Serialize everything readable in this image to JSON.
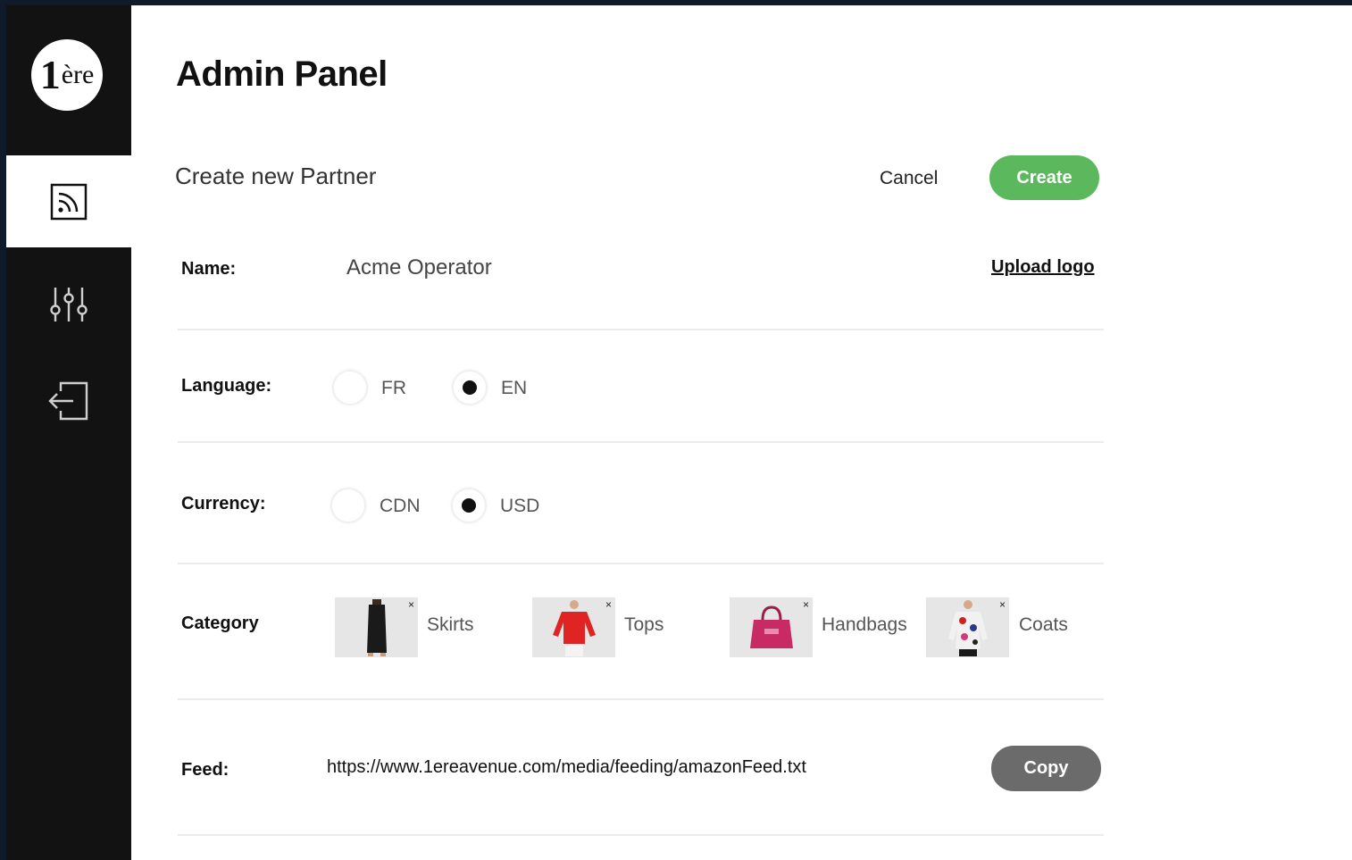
{
  "header": {
    "title": "Admin Panel"
  },
  "sidebar": {
    "logo": {
      "main": "1",
      "sup": "ère"
    },
    "items": [
      {
        "icon": "rss-feed-icon",
        "active": true
      },
      {
        "icon": "sliders-icon",
        "active": false
      },
      {
        "icon": "logout-icon",
        "active": false
      }
    ]
  },
  "form": {
    "subtitle": "Create new Partner",
    "cancel_label": "Cancel",
    "create_label": "Create",
    "name": {
      "label": "Name:",
      "value": "Acme Operator",
      "upload_label": "Upload logo"
    },
    "language": {
      "label": "Language:",
      "options": [
        {
          "label": "FR",
          "selected": false
        },
        {
          "label": "EN",
          "selected": true
        }
      ]
    },
    "currency": {
      "label": "Currency:",
      "options": [
        {
          "label": "CDN",
          "selected": false
        },
        {
          "label": "USD",
          "selected": true
        }
      ]
    },
    "category": {
      "label": "Category",
      "remove_glyph": "×",
      "items": [
        {
          "label": "Skirts",
          "icon": "skirt-image"
        },
        {
          "label": "Tops",
          "icon": "top-image"
        },
        {
          "label": "Handbags",
          "icon": "handbag-image"
        },
        {
          "label": "Coats",
          "icon": "coat-image"
        }
      ]
    },
    "feed": {
      "label": "Feed:",
      "url": "https://www.1ereavenue.com/media/feeding/amazonFeed.txt",
      "copy_label": "Copy"
    }
  },
  "colors": {
    "create_button": "#5cb85c",
    "copy_button": "#6b6b6b",
    "sidebar": "#121212"
  }
}
